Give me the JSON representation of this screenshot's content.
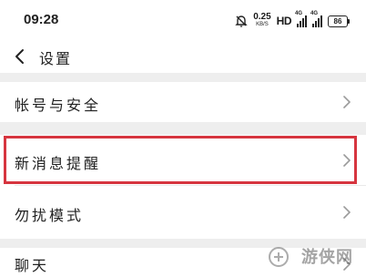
{
  "status_bar": {
    "time": "09:28",
    "speed_value": "0.25",
    "speed_unit": "KB/S",
    "hd": "HD",
    "network_1": "4G",
    "network_2": "4G",
    "battery": "86",
    "icons": [
      "alarm-off-icon",
      "signal-icon",
      "battery-icon"
    ]
  },
  "title_bar": {
    "back_icon": "chevron-left-icon",
    "title": "设置"
  },
  "settings": {
    "items": [
      {
        "label": "帐号与安全",
        "icon": "chevron-right-icon"
      },
      {
        "label": "新消息提醒",
        "icon": "chevron-right-icon",
        "highlighted": true
      },
      {
        "label": "勿扰模式",
        "icon": "chevron-right-icon"
      },
      {
        "label": "聊天",
        "icon": "chevron-right-icon"
      }
    ]
  },
  "colors": {
    "highlight": "#d6353f",
    "separator": "#eeeeee",
    "chevron": "#9a9a9a"
  },
  "watermark": "游侠网"
}
